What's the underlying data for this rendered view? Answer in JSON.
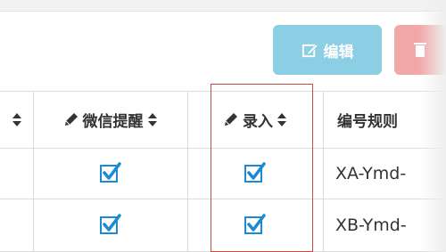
{
  "toolbar": {
    "edit_label": "编辑",
    "delete_label": "",
    "edit_color": "#8ccfe4",
    "delete_color": "#f2a8a8"
  },
  "table": {
    "columns": [
      {
        "label": "",
        "icon": "sort-icon"
      },
      {
        "label": "微信提醒",
        "icon": "pencil-icon"
      },
      {
        "label": "录入",
        "icon": "pencil-icon"
      },
      {
        "label": "编号规则"
      }
    ],
    "rows": [
      {
        "wechat_reminder": true,
        "entry": true,
        "number_rule": "XA-Ymd-"
      },
      {
        "wechat_reminder": true,
        "entry": true,
        "number_rule": "XB-Ymd-"
      }
    ]
  },
  "highlight_color": "#c54b4b"
}
